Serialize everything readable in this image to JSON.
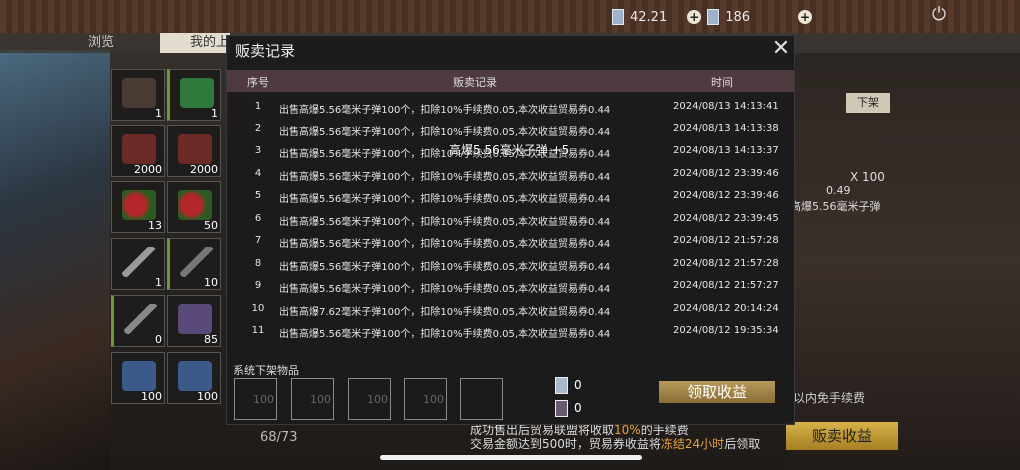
{
  "status": {
    "currency1": "42.21",
    "currency2": "186"
  },
  "tabs": {
    "browse": "浏览",
    "mine": "我的上"
  },
  "inventory": {
    "items": [
      {
        "name": "backpack",
        "count": "1"
      },
      {
        "name": "hazard-box",
        "count": "1"
      },
      {
        "name": "ammo-box",
        "count": "2000"
      },
      {
        "name": "ammo-box",
        "count": "2000"
      },
      {
        "name": "berries",
        "count": "13"
      },
      {
        "name": "berries",
        "count": "50"
      },
      {
        "name": "rifle",
        "count": "1"
      },
      {
        "name": "rifle",
        "count": "10"
      },
      {
        "name": "rifle",
        "count": "0"
      },
      {
        "name": "ammo-pack",
        "count": "85"
      },
      {
        "name": "ammo-pack",
        "count": "100"
      },
      {
        "name": "ammo-pack",
        "count": "100"
      }
    ],
    "capacity": "68/73"
  },
  "listing": {
    "off_shelf": "下架",
    "qty": "X 100",
    "price": "0.49",
    "name": "高爆5.56毫米子弹",
    "fee_note": "以内免手续费"
  },
  "modal": {
    "title": "贩卖记录",
    "headers": {
      "no": "序号",
      "record": "贩卖记录",
      "time": "时间"
    },
    "toast": "高爆5.56毫米子弹 +5",
    "rows": [
      {
        "no": "1",
        "record": "出售高爆5.56毫米子弹100个，扣除10%手续费0.05,本次收益贸易券0.44",
        "time": "2024/08/13 14:13:41"
      },
      {
        "no": "2",
        "record": "出售高爆5.56毫米子弹100个，扣除10%手续费0.05,本次收益贸易券0.44",
        "time": "2024/08/13 14:13:38"
      },
      {
        "no": "3",
        "record": "出售高爆5.56毫米子弹100个，扣除10%手续费0.05,本次收益贸易券0.44",
        "time": "2024/08/13 14:13:37"
      },
      {
        "no": "4",
        "record": "出售高爆5.56毫米子弹100个，扣除10%手续费0.05,本次收益贸易券0.44",
        "time": "2024/08/12 23:39:46"
      },
      {
        "no": "5",
        "record": "出售高爆5.56毫米子弹100个，扣除10%手续费0.05,本次收益贸易券0.44",
        "time": "2024/08/12 23:39:46"
      },
      {
        "no": "6",
        "record": "出售高爆5.56毫米子弹100个，扣除10%手续费0.05,本次收益贸易券0.44",
        "time": "2024/08/12 23:39:45"
      },
      {
        "no": "7",
        "record": "出售高爆5.56毫米子弹100个，扣除10%手续费0.05,本次收益贸易券0.44",
        "time": "2024/08/12 21:57:28"
      },
      {
        "no": "8",
        "record": "出售高爆5.56毫米子弹100个，扣除10%手续费0.05,本次收益贸易券0.44",
        "time": "2024/08/12 21:57:28"
      },
      {
        "no": "9",
        "record": "出售高爆5.56毫米子弹100个，扣除10%手续费0.05,本次收益贸易券0.44",
        "time": "2024/08/12 21:57:27"
      },
      {
        "no": "10",
        "record": "出售高爆7.62毫米子弹100个，扣除10%手续费0.05,本次收益贸易券0.44",
        "time": "2024/08/12 20:14:24"
      },
      {
        "no": "11",
        "record": "出售高爆5.56毫米子弹100个，扣除10%手续费0.05,本次收益贸易券0.44",
        "time": "2024/08/12 19:35:34"
      }
    ],
    "sys_label": "系统下架物品",
    "sys_slots": [
      "100",
      "100",
      "100",
      "100",
      ""
    ],
    "earn_trade": "0",
    "earn_other": "0",
    "claim": "领取收益"
  },
  "footer": {
    "line1_a": "成功售出后贸易联盟将收取",
    "line1_hl": "10%",
    "line1_b": "的手续费",
    "line2_a": "交易金额达到500时，贸易券收益将",
    "line2_hl": "冻结24小时",
    "line2_b": "后领取",
    "sell_income": "贩卖收益"
  }
}
